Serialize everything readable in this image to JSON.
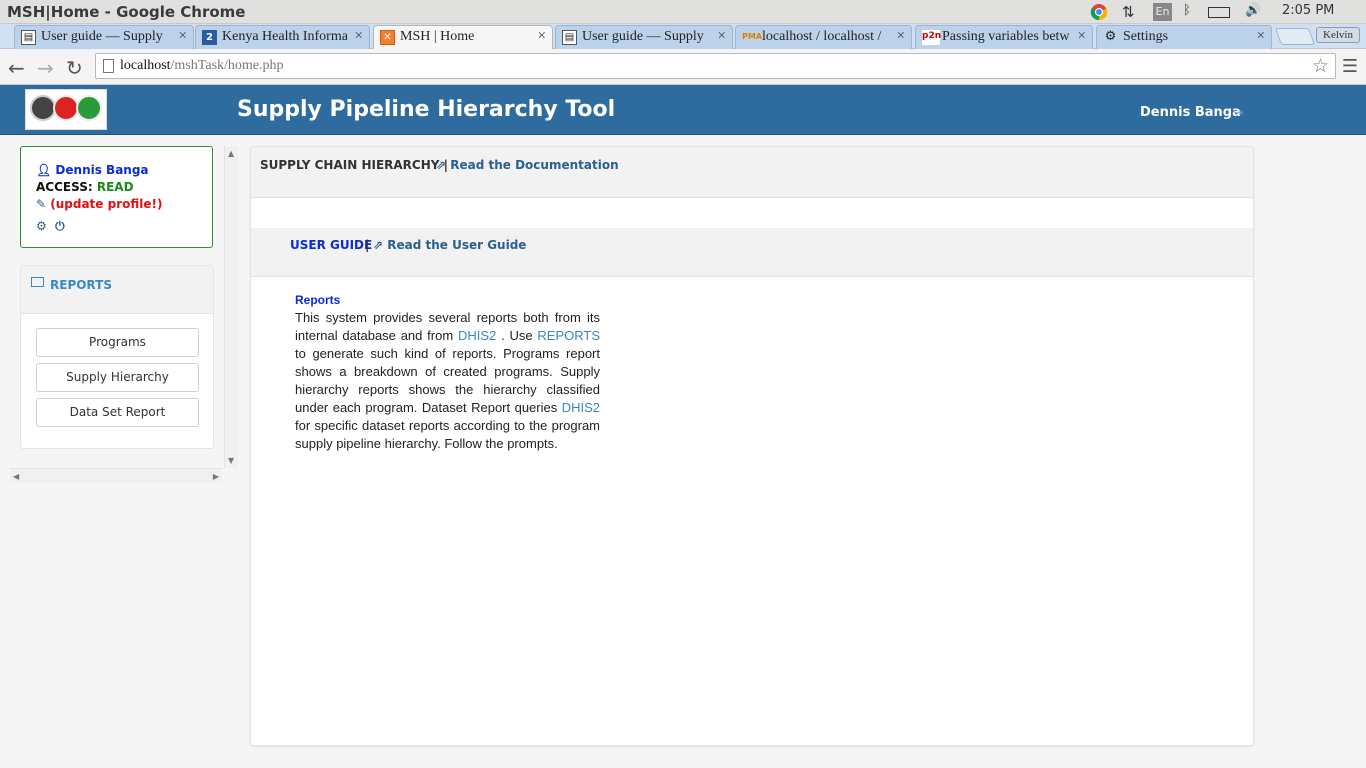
{
  "os": {
    "window_title": "MSH|Home - Google Chrome",
    "lang": "En",
    "clock": "2:05 PM",
    "profile": "Kelvin"
  },
  "tabs": [
    {
      "label": "User guide — Supply",
      "icon": "book-icon"
    },
    {
      "label": "Kenya Health Informa",
      "icon": "number-2-icon"
    },
    {
      "label": "MSH | Home",
      "icon": "app-icon"
    },
    {
      "label": "User guide — Supply",
      "icon": "book-icon"
    },
    {
      "label": "localhost / localhost /",
      "icon": "pma-icon"
    },
    {
      "label": "Passing variables betw",
      "icon": "p2n-icon"
    },
    {
      "label": "Settings",
      "icon": "gear-icon"
    }
  ],
  "address": {
    "host": "localhost",
    "path": "/mshTask/home.php"
  },
  "app": {
    "title": "Supply Pipeline Hierarchy Tool",
    "user": "Dennis Banga"
  },
  "profile": {
    "name": "Dennis Banga",
    "access_label": "ACCESS:",
    "access_value": "READ",
    "update_link": "(update profile!)"
  },
  "sidebar": {
    "heading": "REPORTS",
    "buttons": [
      "Programs",
      "Supply Hierarchy",
      "Data Set Report"
    ]
  },
  "main": {
    "sc_title": "SUPPLY CHAIN HIERARCHY |",
    "sc_link": "Read the Documentation",
    "ug_title": "USER GUIDE",
    "ug_sep": "|",
    "ug_link": "Read the User Guide",
    "rep_title": "Reports",
    "rep_text_1": "This system provides several reports both from its internal database and from",
    "rep_dhis_1": "DHIS2",
    "rep_text_2": ". Use",
    "rep_reports": "REPORTS",
    "rep_text_3": "to generate such kind of reports. Programs report shows a breakdown of created programs. Supply hierarchy reports shows the hierarchy classified under each program. Dataset Report queries",
    "rep_dhis_2": "DHIS2",
    "rep_text_4": "for specific dataset reports according to the program supply pipeline hierarchy. Follow the prompts."
  },
  "colors": {
    "header_bg": "#2e6b9e",
    "access_read": "#1a8a1a",
    "update_link": "#e01010",
    "link_blue": "#3a87c7",
    "heading_blue": "#0b2bd6"
  }
}
